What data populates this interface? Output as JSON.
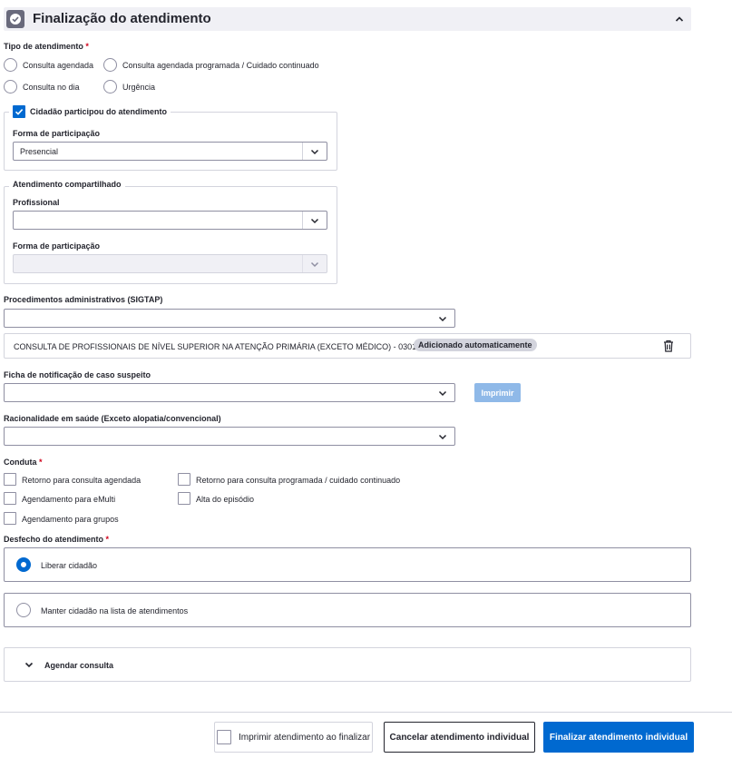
{
  "header": {
    "title": "Finalização do atendimento"
  },
  "tipo": {
    "label": "Tipo de atendimento",
    "required": "*",
    "options": [
      "Consulta agendada",
      "Consulta agendada programada / Cuidado continuado",
      "Consulta no dia",
      "Urgência"
    ]
  },
  "cidadao": {
    "checkbox_label": "Cidadão participou do atendimento",
    "forma_label": "Forma de participação",
    "forma_value": "Presencial"
  },
  "compartilhado": {
    "legend": "Atendimento compartilhado",
    "profissional_label": "Profissional",
    "forma_label": "Forma de participação"
  },
  "procedimentos": {
    "label": "Procedimentos administrativos (SIGTAP)",
    "item": "CONSULTA DE PROFISSIONAIS DE NÍVEL SUPERIOR NA ATENÇÃO PRIMÁRIA (EXCETO MÉDICO) - 0301010030",
    "badge": "Adicionado automaticamente"
  },
  "ficha": {
    "label": "Ficha de notificação de caso suspeito",
    "print_button": "Imprimir"
  },
  "racionalidade": {
    "label": "Racionalidade em saúde (Exceto alopatia/convencional)"
  },
  "conduta": {
    "label": "Conduta",
    "required": "*",
    "options": [
      "Retorno para consulta agendada",
      "Retorno para consulta programada / cuidado continuado",
      "Agendamento para eMulti",
      "Alta do episódio",
      "Agendamento para grupos"
    ]
  },
  "desfecho": {
    "label": "Desfecho do atendimento",
    "required": "*",
    "options": [
      "Liberar cidadão",
      "Manter cidadão na lista de atendimentos"
    ]
  },
  "agendar": {
    "label": "Agendar consulta"
  },
  "footer": {
    "print_check_label": "Imprimir atendimento ao finalizar",
    "cancel_button": "Cancelar atendimento individual",
    "finish_button": "Finalizar atendimento individual"
  },
  "colors": {
    "primary": "#0069d0",
    "required": "#d0021b",
    "header_bg": "#f0f0f5"
  },
  "icons": [
    "check-circle-icon",
    "chevron-up-icon",
    "chevron-down-icon",
    "check-icon",
    "trash-icon"
  ]
}
